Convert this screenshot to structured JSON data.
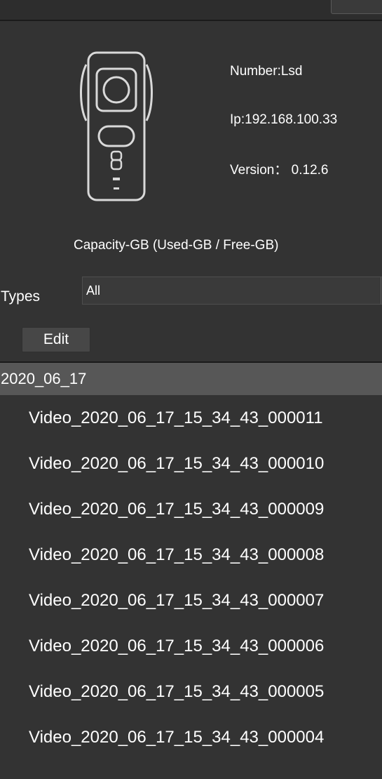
{
  "device": {
    "number": "Number:Lsd",
    "ip": "Ip:192.168.100.33",
    "version": "Version： 0.12.6",
    "capacity": "Capacity-GB (Used-GB / Free-GB)"
  },
  "filter": {
    "types_label": "Types",
    "types_value": "All"
  },
  "actions": {
    "edit_label": "Edit"
  },
  "files": {
    "group": "2020_06_17",
    "items": [
      "Video_2020_06_17_15_34_43_000011",
      "Video_2020_06_17_15_34_43_000010",
      "Video_2020_06_17_15_34_43_000009",
      "Video_2020_06_17_15_34_43_000008",
      "Video_2020_06_17_15_34_43_000007",
      "Video_2020_06_17_15_34_43_000006",
      "Video_2020_06_17_15_34_43_000005",
      "Video_2020_06_17_15_34_43_000004"
    ]
  },
  "icons": {
    "device": "camera-icon"
  },
  "colors": {
    "background": "#333333",
    "group_header": "#575757",
    "text": "#ffffff"
  }
}
